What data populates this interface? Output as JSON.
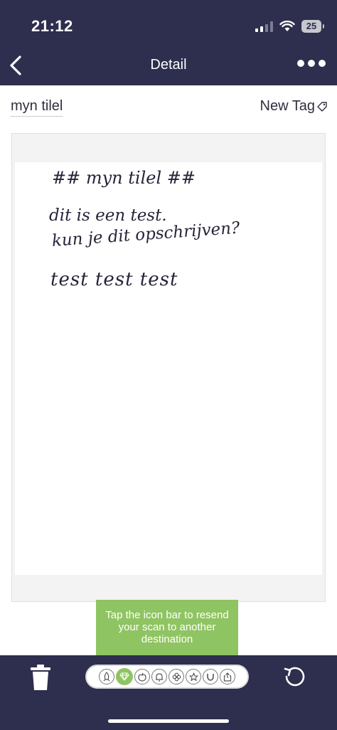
{
  "status": {
    "time": "21:12",
    "battery": "25"
  },
  "nav": {
    "title": "Detail"
  },
  "document": {
    "title": "myn tilel",
    "tag_label": "New Tag",
    "handwriting": [
      "## myn tilel ##",
      "dit is een test.",
      "kun je dit opschrijven?",
      "test test test"
    ]
  },
  "tooltip": {
    "text": "Tap the icon bar to resend your scan to another destination"
  },
  "icon_bar": {
    "icons": [
      "rocket-icon",
      "diamond-icon",
      "apple-icon",
      "bell-icon",
      "clover-icon",
      "star-icon",
      "horseshoe-icon",
      "share-icon"
    ],
    "active": "diamond-icon",
    "accent": "#8fc462"
  },
  "colors": {
    "bar": "#2e2e4e",
    "accent": "#8fc462"
  }
}
